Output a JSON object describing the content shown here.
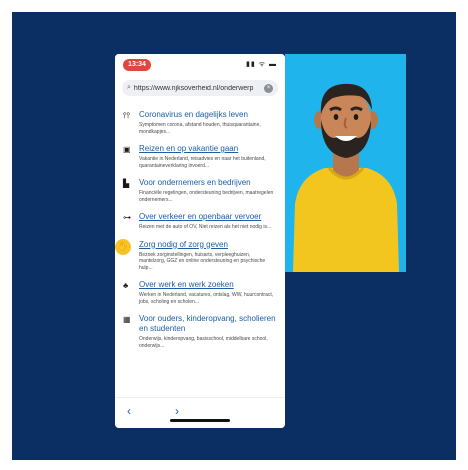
{
  "status": {
    "time": "13:34",
    "signal": "▮▮ ᯤ ▬"
  },
  "browser": {
    "url": "https://www.rijksoverheid.nl/onderwerp",
    "clear": "×"
  },
  "items": [
    {
      "icon": "⫯⫯",
      "title": "Coronavirus en dagelijks leven",
      "desc": "Symptomen corona, afstand houden, thuisquarantaine, mondkapjes..."
    },
    {
      "icon": "▣",
      "title": "Reizen en op vakantie gaan",
      "desc": "Vakantie in Nederland, reisadvies en naar het buitenland, quarantaineverklaring invoerd..."
    },
    {
      "icon": "▙",
      "title": "Voor ondernemers en bedrijven",
      "desc": "Financiële regelingen, ondersteuning bedrijven, maatregelen ondernemers..."
    },
    {
      "icon": "⊶",
      "title": "Over verkeer en openbaar vervoer",
      "desc": "Reizen met de auto of OV, Niet reizen als het niet nodig is..."
    },
    {
      "icon": "✋",
      "title": "Zorg nodig of zorg geven",
      "desc": "Bezoek zorginstellingen, huisarts, verpleeghuizen, mantelzorg, GGZ en online ondersteuning en psychische hulp..."
    },
    {
      "icon": "♣",
      "title": "Over werk en werk zoeken",
      "desc": "Werken in Nederland, vacatures, ontslag, WW, huurcontract, jobs, scholing en scholen..."
    },
    {
      "icon": "▦",
      "title": "Voor ouders, kinderopvang, scholieren en studenten",
      "desc": "Onderwijs, kinderopvang, basisschool, middelbare school, onderwijs..."
    }
  ],
  "nav": {
    "back": "‹",
    "forward": "›"
  },
  "colors": {
    "frame": "#0b2f62",
    "link": "#1c5da6",
    "avatar_bg": "#1fb4ec",
    "highlight": "#f7c325"
  }
}
